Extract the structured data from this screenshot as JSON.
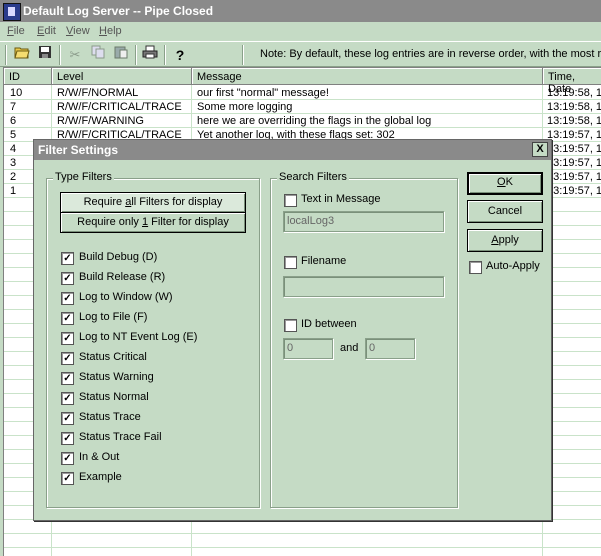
{
  "window": {
    "title": "Default Log Server -- Pipe Closed",
    "menu": [
      {
        "pre": "",
        "u": "F",
        "post": "ile"
      },
      {
        "pre": "",
        "u": "E",
        "post": "dit"
      },
      {
        "pre": "",
        "u": "V",
        "post": "iew"
      },
      {
        "pre": "",
        "u": "H",
        "post": "elp"
      }
    ],
    "toolbar_icons": [
      "open-icon",
      "save-icon",
      "cut-icon",
      "copy-icon",
      "paste-icon",
      "print-icon",
      "help-icon"
    ],
    "note": "Note:  By default, these log entries are in reverse order, with the most rec"
  },
  "log": {
    "columns": [
      "ID",
      "Level",
      "Message",
      "Time, Date"
    ],
    "rows": [
      {
        "id": "10",
        "level": "R/W/F/NORMAL",
        "message": "our first \"normal\" message!",
        "time": "13:19:58, 1"
      },
      {
        "id": "7",
        "level": "R/W/F/CRITICAL/TRACE",
        "message": "Some more logging",
        "time": "13:19:58, 1"
      },
      {
        "id": "6",
        "level": "R/W/F/WARNING",
        "message": "here we are overriding the flags in the global log",
        "time": "13:19:58, 1"
      },
      {
        "id": "5",
        "level": "R/W/F/CRITICAL/TRACE",
        "message": "Yet another log, with these flags set: 302",
        "time": "13:19:57, 1"
      },
      {
        "id": "4",
        "level": "",
        "message": "",
        "time": "13:19:57, 1"
      },
      {
        "id": "3",
        "level": "",
        "message": "",
        "time": "13:19:57, 1"
      },
      {
        "id": "2",
        "level": "",
        "message": "",
        "time": "13:19:57, 1"
      },
      {
        "id": "1",
        "level": "",
        "message": "",
        "time": "13:19:57, 1"
      }
    ]
  },
  "dialog": {
    "title": "Filter Settings",
    "close": "X",
    "type_filters": {
      "label": "Type Filters",
      "require_all": {
        "pre": "Require ",
        "u": "a",
        "post": "ll Filters for display"
      },
      "require_one": {
        "pre": "Require only ",
        "u": "1",
        "post": " Filter for display"
      },
      "items": [
        {
          "label": "Build Debug (D)",
          "checked": true
        },
        {
          "label": "Build Release (R)",
          "checked": true
        },
        {
          "label": "Log to Window (W)",
          "checked": true
        },
        {
          "label": "Log to File (F)",
          "checked": true
        },
        {
          "label": "Log to NT Event Log (E)",
          "checked": true
        },
        {
          "label": "Status Critical",
          "checked": true
        },
        {
          "label": "Status Warning",
          "checked": true
        },
        {
          "label": "Status Normal",
          "checked": true
        },
        {
          "label": "Status Trace",
          "checked": true
        },
        {
          "label": "Status Trace Fail",
          "checked": true
        },
        {
          "label": "In & Out",
          "checked": true
        },
        {
          "label": "Example",
          "checked": true
        }
      ]
    },
    "search_filters": {
      "label": "Search Filters",
      "text_in_message": {
        "label": "Text in Message",
        "checked": false,
        "value": "localLog3"
      },
      "filename": {
        "label": "Filename",
        "checked": false,
        "value": ""
      },
      "id_between": {
        "label": "ID between",
        "checked": false,
        "from": "0",
        "and": "and",
        "to": "0"
      }
    },
    "buttons": {
      "ok": {
        "pre": "",
        "u": "O",
        "post": "K"
      },
      "cancel": "Cancel",
      "apply": {
        "pre": "",
        "u": "A",
        "post": "pply"
      },
      "auto_apply": {
        "label": "Auto-Apply",
        "checked": false
      }
    }
  }
}
